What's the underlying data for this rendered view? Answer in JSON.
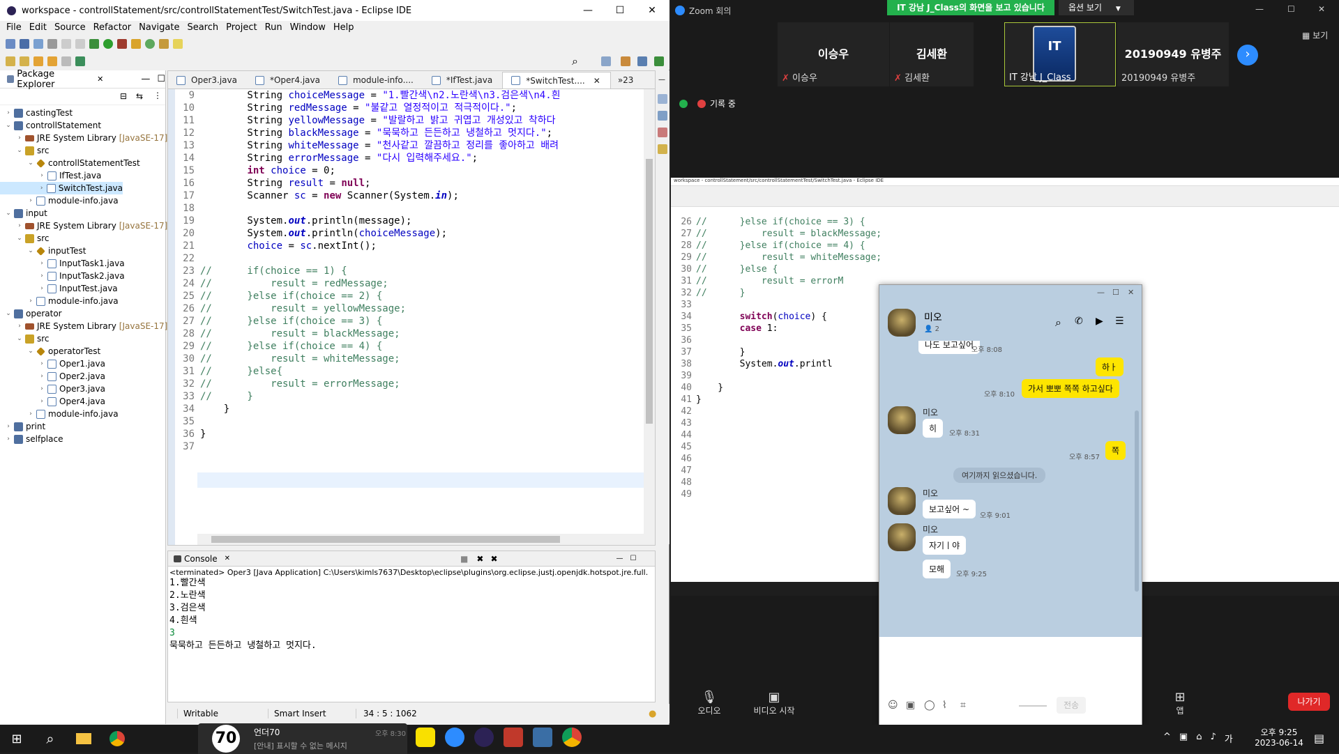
{
  "eclipse": {
    "title": "workspace - controllStatement/src/controllStatementTest/SwitchTest.java - Eclipse IDE",
    "menu": [
      "File",
      "Edit",
      "Source",
      "Refactor",
      "Navigate",
      "Search",
      "Project",
      "Run",
      "Window",
      "Help"
    ],
    "package_explorer": {
      "title": "Package Explorer",
      "items": [
        {
          "label": "castingTest",
          "sub": ""
        },
        {
          "label": "controllStatement",
          "sub": ""
        },
        {
          "label": "JRE System Library",
          "sub": "[JavaSE-17]"
        },
        {
          "label": "src",
          "sub": ""
        },
        {
          "label": "controllStatementTest",
          "sub": ""
        },
        {
          "label": "IfTest.java",
          "sub": ""
        },
        {
          "label": "SwitchTest.java",
          "sub": ""
        },
        {
          "label": "module-info.java",
          "sub": ""
        },
        {
          "label": "input",
          "sub": ""
        },
        {
          "label": "JRE System Library",
          "sub": "[JavaSE-17]"
        },
        {
          "label": "src",
          "sub": ""
        },
        {
          "label": "inputTest",
          "sub": ""
        },
        {
          "label": "InputTask1.java",
          "sub": ""
        },
        {
          "label": "InputTask2.java",
          "sub": ""
        },
        {
          "label": "InputTest.java",
          "sub": ""
        },
        {
          "label": "module-info.java",
          "sub": ""
        },
        {
          "label": "operator",
          "sub": ""
        },
        {
          "label": "JRE System Library",
          "sub": "[JavaSE-17]"
        },
        {
          "label": "src",
          "sub": ""
        },
        {
          "label": "operatorTest",
          "sub": ""
        },
        {
          "label": "Oper1.java",
          "sub": ""
        },
        {
          "label": "Oper2.java",
          "sub": ""
        },
        {
          "label": "Oper3.java",
          "sub": ""
        },
        {
          "label": "Oper4.java",
          "sub": ""
        },
        {
          "label": "module-info.java",
          "sub": ""
        },
        {
          "label": "print",
          "sub": ""
        },
        {
          "label": "selfplace",
          "sub": ""
        }
      ]
    },
    "tabs": [
      "Oper3.java",
      "*Oper4.java",
      "module-info....",
      "*IfTest.java",
      "*SwitchTest....",
      "»23"
    ],
    "code_lines": [
      {
        "n": "9",
        "t": "        String choiceMessage = \"1.빨간색\\n2.노란색\\n3.검은색\\n4.흰"
      },
      {
        "n": "10",
        "t": "        String redMessage = \"불같고 열정적이고 적극적이다.\";"
      },
      {
        "n": "11",
        "t": "        String yellowMessage = \"발랄하고 밝고 귀엽고 개성있고 착하다"
      },
      {
        "n": "12",
        "t": "        String blackMessage = \"묵묵하고 든든하고 냉철하고 멋지다.\";"
      },
      {
        "n": "13",
        "t": "        String whiteMessage = \"천사같고 깔끔하고 정리를 좋아하고 배려"
      },
      {
        "n": "14",
        "t": "        String errorMessage = \"다시 입력해주세요.\";"
      },
      {
        "n": "15",
        "t": "        int choice = 0;"
      },
      {
        "n": "16",
        "t": "        String result = null;"
      },
      {
        "n": "17",
        "t": "        Scanner sc = new Scanner(System.in);"
      },
      {
        "n": "18",
        "t": ""
      },
      {
        "n": "19",
        "t": "        System.out.println(message);"
      },
      {
        "n": "20",
        "t": "        System.out.println(choiceMessage);"
      },
      {
        "n": "21",
        "t": "        choice = sc.nextInt();"
      },
      {
        "n": "22",
        "t": ""
      },
      {
        "n": "23",
        "t": "//      if(choice == 1) {"
      },
      {
        "n": "24",
        "t": "//          result = redMessage;"
      },
      {
        "n": "25",
        "t": "//      }else if(choice == 2) {"
      },
      {
        "n": "26",
        "t": "//          result = yellowMessage;"
      },
      {
        "n": "27",
        "t": "//      }else if(choice == 3) {"
      },
      {
        "n": "28",
        "t": "//          result = blackMessage;"
      },
      {
        "n": "29",
        "t": "//      }else if(choice == 4) {"
      },
      {
        "n": "30",
        "t": "//          result = whiteMessage;"
      },
      {
        "n": "31",
        "t": "//      }else{"
      },
      {
        "n": "32",
        "t": "//          result = errorMessage;"
      },
      {
        "n": "33",
        "t": "//      }"
      },
      {
        "n": "34",
        "t": "    }"
      },
      {
        "n": "35",
        "t": ""
      },
      {
        "n": "36",
        "t": "}"
      },
      {
        "n": "37",
        "t": ""
      }
    ],
    "console": {
      "title": "Console",
      "header": "<terminated> Oper3 [Java Application] C:\\Users\\kimls7637\\Desktop\\eclipse\\plugins\\org.eclipse.justj.openjdk.hotspot.jre.full.",
      "lines": [
        "1.빨간색",
        "2.노란색",
        "3.검은색",
        "4.흰색",
        "3",
        "묵묵하고 든든하고 냉철하고 멋지다."
      ]
    },
    "status": {
      "mode": "Writable",
      "insert": "Smart Insert",
      "pos": "34 : 5 : 1062"
    }
  },
  "zoom": {
    "title": "Zoom 회의",
    "share_banner": "IT 강남 J_Class의 화면을 보고 있습니다",
    "options": "옵션 보기",
    "view": "보기",
    "recording": "기록 중",
    "participants": [
      {
        "name": "이승우",
        "sub": "이승우"
      },
      {
        "name": "김세환",
        "sub": "김세환"
      },
      {
        "name": "",
        "sub": "IT 강남 J_Class"
      },
      {
        "name": "20190949 유병주",
        "sub": "20190949 유병주"
      }
    ],
    "bottom": {
      "audio": "오디오",
      "video": "비디오 시작",
      "leave": "나가기",
      "apps": "앱"
    },
    "shared_title": "workspace - controllStatement/src/controllStatementTest/SwitchTest.java - Eclipse IDE",
    "shared_lines": [
      {
        "n": "26",
        "t": "//      }else if(choice == 3) {"
      },
      {
        "n": "27",
        "t": "//          result = blackMessage;"
      },
      {
        "n": "28",
        "t": "//      }else if(choice == 4) {"
      },
      {
        "n": "29",
        "t": "//          result = whiteMessage;"
      },
      {
        "n": "30",
        "t": "//      }else {"
      },
      {
        "n": "31",
        "t": "//          result = errorM"
      },
      {
        "n": "32",
        "t": "//      }"
      },
      {
        "n": "33",
        "t": ""
      },
      {
        "n": "34",
        "t": "        switch(choice) {"
      },
      {
        "n": "35",
        "t": "        case 1:"
      },
      {
        "n": "36",
        "t": ""
      },
      {
        "n": "37",
        "t": "        }"
      },
      {
        "n": "38",
        "t": "        System.out.printl"
      },
      {
        "n": "39",
        "t": ""
      },
      {
        "n": "40",
        "t": "    }"
      },
      {
        "n": "41",
        "t": "}"
      },
      {
        "n": "42",
        "t": ""
      },
      {
        "n": "43",
        "t": ""
      },
      {
        "n": "44",
        "t": ""
      },
      {
        "n": "45",
        "t": ""
      },
      {
        "n": "46",
        "t": ""
      },
      {
        "n": "47",
        "t": ""
      },
      {
        "n": "48",
        "t": ""
      },
      {
        "n": "49",
        "t": ""
      }
    ]
  },
  "kakao": {
    "chat_name": "미오",
    "members": "2",
    "messages": [
      {
        "type": "other",
        "text": "나도 보고싶어",
        "time": "오후 8:08"
      },
      {
        "type": "me",
        "text": "하ㅏ",
        "time": ""
      },
      {
        "type": "me",
        "text": "가서 뽀뽀 쪽쪽 하고싶다",
        "time": "오후 8:10"
      },
      {
        "type": "other",
        "name": "미오",
        "text": "히",
        "time": "오후 8:31"
      },
      {
        "type": "me",
        "text": "쪽",
        "time": "오후 8:57"
      },
      {
        "type": "notice",
        "text": "여기까지 읽으셨습니다."
      },
      {
        "type": "other",
        "name": "미오",
        "text": "보고싶어 ~",
        "time": "오후 9:01"
      },
      {
        "type": "other",
        "name": "미오",
        "text": "자기ㅣ야",
        "time": ""
      },
      {
        "type": "other",
        "text": "모해",
        "time": "오후 9:25"
      }
    ],
    "send": "전송"
  },
  "taskbar": {
    "notif_title": "언더70",
    "notif_text": "[안내] 표시할 수 없는 메시지",
    "notif_time": "오후 8:30",
    "clock_time": "오후 9:25",
    "clock_date": "2023-06-14",
    "ime": "가"
  }
}
